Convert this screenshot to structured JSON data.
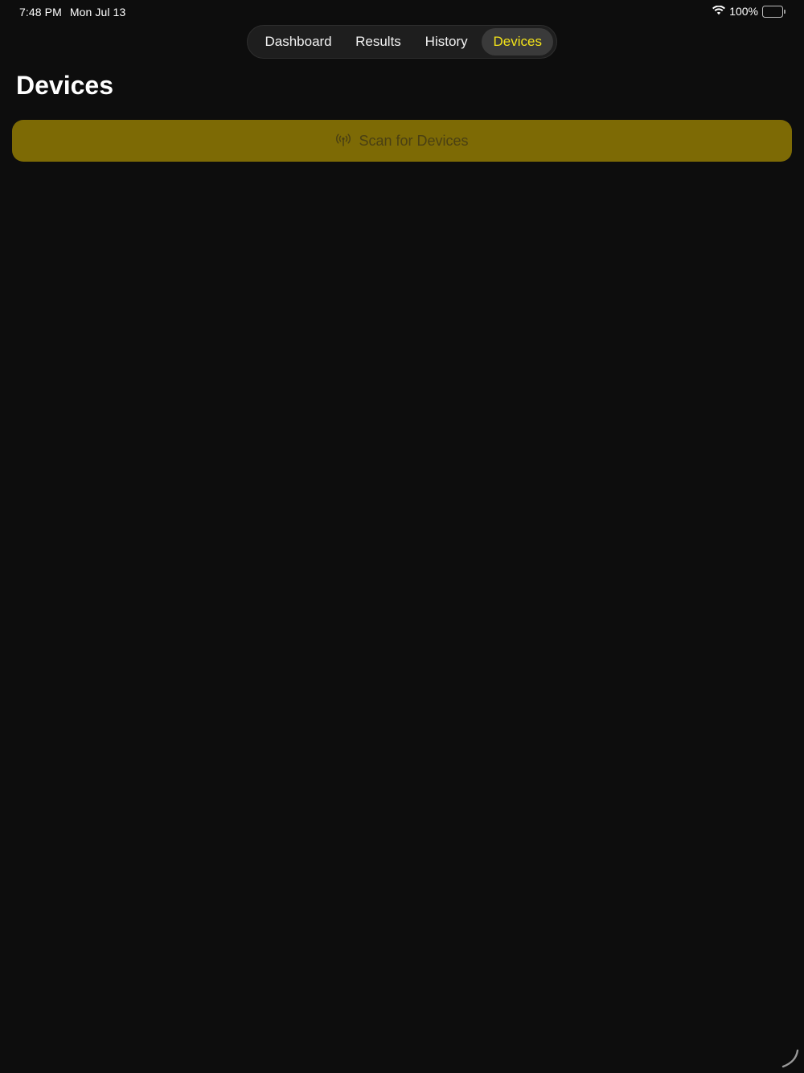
{
  "status_bar": {
    "time": "7:48 PM",
    "date": "Mon Jul 13",
    "battery_percent": "100%",
    "battery_level": 1.0,
    "wifi_icon": "wifi-icon",
    "battery_icon": "battery-icon"
  },
  "tabs": [
    {
      "label": "Dashboard",
      "selected": false
    },
    {
      "label": "Results",
      "selected": false
    },
    {
      "label": "History",
      "selected": false
    },
    {
      "label": "Devices",
      "selected": true
    }
  ],
  "page": {
    "title": "Devices"
  },
  "scan_button": {
    "label": "Scan for Devices",
    "icon": "antenna-icon",
    "enabled": false
  },
  "colors": {
    "background": "#0d0d0d",
    "accent": "#f2e21a",
    "button_fill": "#7d6a05",
    "button_text": "#4a4013"
  }
}
